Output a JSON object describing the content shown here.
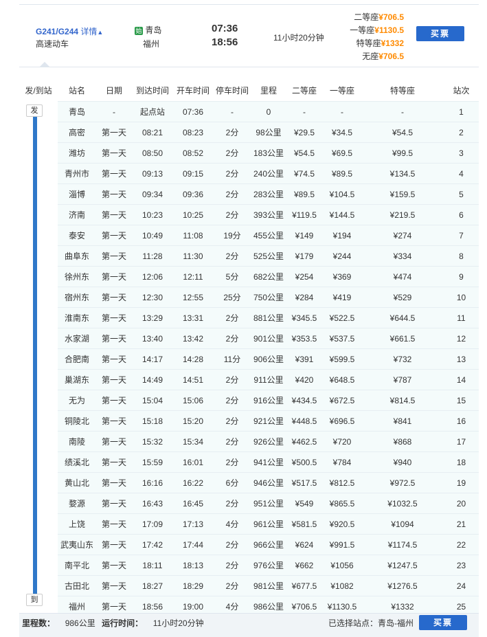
{
  "train": {
    "code": "G241/G244",
    "detail_label": "详情",
    "detail_caret": "▲",
    "type": "高速动车",
    "start_badge": "始",
    "from": "青岛",
    "to": "福州",
    "depart_time": "07:36",
    "arrive_time": "18:56",
    "duration": "11小时20分钟",
    "prices": [
      {
        "label": "二等座",
        "price": "¥706.5"
      },
      {
        "label": "一等座",
        "price": "¥1130.5"
      },
      {
        "label": "特等座",
        "price": "¥1332"
      },
      {
        "label": "无座",
        "price": "¥706.5"
      }
    ],
    "buy_label": "买票"
  },
  "table": {
    "headers": [
      "发/到站",
      "站名",
      "日期",
      "到达时间",
      "开车时间",
      "停车时间",
      "里程",
      "二等座",
      "一等座",
      "特等座",
      "站次"
    ],
    "depart_tag": "发",
    "arrive_tag": "到",
    "rows": [
      [
        "青岛",
        "-",
        "起点站",
        "07:36",
        "-",
        "0",
        "-",
        "-",
        "-",
        "1"
      ],
      [
        "高密",
        "第一天",
        "08:21",
        "08:23",
        "2分",
        "98公里",
        "¥29.5",
        "¥34.5",
        "¥54.5",
        "2"
      ],
      [
        "潍坊",
        "第一天",
        "08:50",
        "08:52",
        "2分",
        "183公里",
        "¥54.5",
        "¥69.5",
        "¥99.5",
        "3"
      ],
      [
        "青州市",
        "第一天",
        "09:13",
        "09:15",
        "2分",
        "240公里",
        "¥74.5",
        "¥89.5",
        "¥134.5",
        "4"
      ],
      [
        "淄博",
        "第一天",
        "09:34",
        "09:36",
        "2分",
        "283公里",
        "¥89.5",
        "¥104.5",
        "¥159.5",
        "5"
      ],
      [
        "济南",
        "第一天",
        "10:23",
        "10:25",
        "2分",
        "393公里",
        "¥119.5",
        "¥144.5",
        "¥219.5",
        "6"
      ],
      [
        "泰安",
        "第一天",
        "10:49",
        "11:08",
        "19分",
        "455公里",
        "¥149",
        "¥194",
        "¥274",
        "7"
      ],
      [
        "曲阜东",
        "第一天",
        "11:28",
        "11:30",
        "2分",
        "525公里",
        "¥179",
        "¥244",
        "¥334",
        "8"
      ],
      [
        "徐州东",
        "第一天",
        "12:06",
        "12:11",
        "5分",
        "682公里",
        "¥254",
        "¥369",
        "¥474",
        "9"
      ],
      [
        "宿州东",
        "第一天",
        "12:30",
        "12:55",
        "25分",
        "750公里",
        "¥284",
        "¥419",
        "¥529",
        "10"
      ],
      [
        "淮南东",
        "第一天",
        "13:29",
        "13:31",
        "2分",
        "881公里",
        "¥345.5",
        "¥522.5",
        "¥644.5",
        "11"
      ],
      [
        "水家湖",
        "第一天",
        "13:40",
        "13:42",
        "2分",
        "901公里",
        "¥353.5",
        "¥537.5",
        "¥661.5",
        "12"
      ],
      [
        "合肥南",
        "第一天",
        "14:17",
        "14:28",
        "11分",
        "906公里",
        "¥391",
        "¥599.5",
        "¥732",
        "13"
      ],
      [
        "巢湖东",
        "第一天",
        "14:49",
        "14:51",
        "2分",
        "911公里",
        "¥420",
        "¥648.5",
        "¥787",
        "14"
      ],
      [
        "无为",
        "第一天",
        "15:04",
        "15:06",
        "2分",
        "916公里",
        "¥434.5",
        "¥672.5",
        "¥814.5",
        "15"
      ],
      [
        "铜陵北",
        "第一天",
        "15:18",
        "15:20",
        "2分",
        "921公里",
        "¥448.5",
        "¥696.5",
        "¥841",
        "16"
      ],
      [
        "南陵",
        "第一天",
        "15:32",
        "15:34",
        "2分",
        "926公里",
        "¥462.5",
        "¥720",
        "¥868",
        "17"
      ],
      [
        "绩溪北",
        "第一天",
        "15:59",
        "16:01",
        "2分",
        "941公里",
        "¥500.5",
        "¥784",
        "¥940",
        "18"
      ],
      [
        "黄山北",
        "第一天",
        "16:16",
        "16:22",
        "6分",
        "946公里",
        "¥517.5",
        "¥812.5",
        "¥972.5",
        "19"
      ],
      [
        "婺源",
        "第一天",
        "16:43",
        "16:45",
        "2分",
        "951公里",
        "¥549",
        "¥865.5",
        "¥1032.5",
        "20"
      ],
      [
        "上饶",
        "第一天",
        "17:09",
        "17:13",
        "4分",
        "961公里",
        "¥581.5",
        "¥920.5",
        "¥1094",
        "21"
      ],
      [
        "武夷山东",
        "第一天",
        "17:42",
        "17:44",
        "2分",
        "966公里",
        "¥624",
        "¥991.5",
        "¥1174.5",
        "22"
      ],
      [
        "南平北",
        "第一天",
        "18:11",
        "18:13",
        "2分",
        "976公里",
        "¥662",
        "¥1056",
        "¥1247.5",
        "23"
      ],
      [
        "古田北",
        "第一天",
        "18:27",
        "18:29",
        "2分",
        "981公里",
        "¥677.5",
        "¥1082",
        "¥1276.5",
        "24"
      ],
      [
        "福州",
        "第一天",
        "18:56",
        "19:00",
        "4分",
        "986公里",
        "¥706.5",
        "¥1130.5",
        "¥1332",
        "25"
      ]
    ]
  },
  "footer": {
    "distance_label": "里程数：",
    "distance": "986公里",
    "runtime_label": "运行时间：",
    "runtime": "11小时20分钟",
    "selected_label": "已选择站点：",
    "selected_value": "青岛-福州",
    "buy_label": "买票"
  },
  "colors": {
    "price_orange": "#ff8a00",
    "link_blue": "#3366cc",
    "button_blue": "#2769cc",
    "track_blue": "#2f78c9",
    "start_badge_green": "#2b9b4a",
    "row_bg": "#f4fbfb"
  }
}
